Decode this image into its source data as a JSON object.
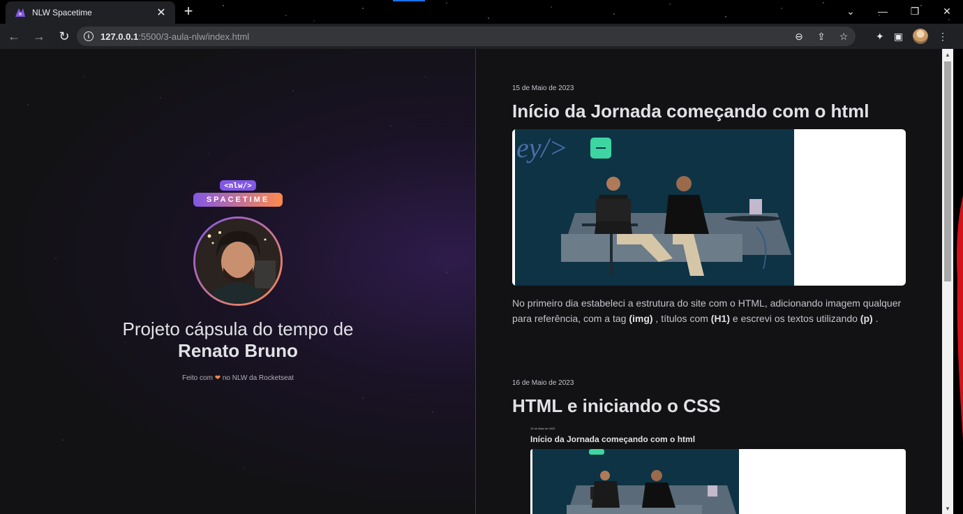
{
  "browser": {
    "tab_title": "NLW Spacetime",
    "tab_close": "✕",
    "new_tab": "+",
    "url_host": "127.0.0.1",
    "url_path": ":5500/3-aula-nlw/index.html",
    "info_icon": "i"
  },
  "profile": {
    "logo_tag": "<nlw/>",
    "logo_word": "SPACETIME",
    "headline": "Projeto cápsula do tempo de",
    "name": "Renato Bruno",
    "credits_before": "Feito com",
    "credits_heart": "❤",
    "credits_after": "no NLW da Rocketseat"
  },
  "entries": [
    {
      "date": "15 de Maio de 2023",
      "title": "Início da Jornada começando com o html",
      "text_1": "No primeiro dia estabeleci a estrutura do site com o HTML, adicionando imagem qualquer para referência, com a tag",
      "tag_img": "(img)",
      "text_2": ", títulos com",
      "tag_h1": "(H1)",
      "text_3": "e escrevi os textos utilizando",
      "tag_p": "(p)",
      "text_4": "."
    },
    {
      "date": "16 de Maio de 2023",
      "title": "HTML e iniciando o CSS"
    }
  ],
  "nested_preview": {
    "date": "15 de Maio de 2023",
    "title": "Início da Jornada começando com o html"
  },
  "colors": {
    "brand_purple": "#8257e5",
    "brand_orange": "#ff8a4c",
    "page_bg": "#121214"
  }
}
